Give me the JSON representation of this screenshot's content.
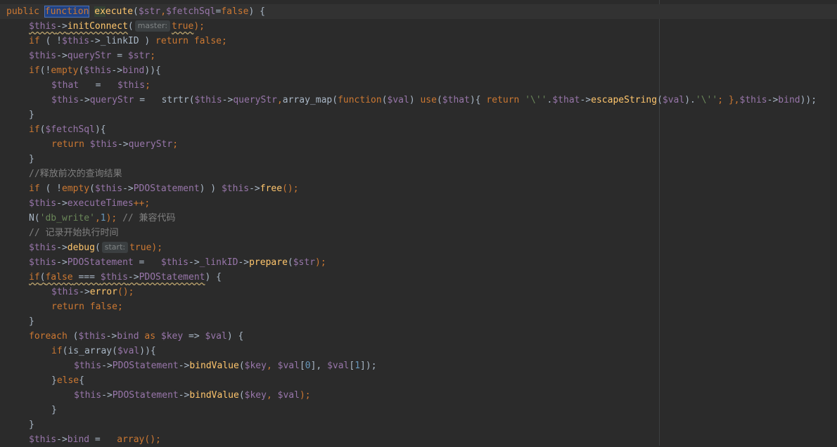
{
  "editor": {
    "line0": {
      "kw_public": "public",
      "kw_function": "function",
      "fn_name_a": "ex",
      "fn_name_b": "ecute",
      "paren": "(",
      "p1": "$str",
      "comma": ",",
      "p2": "$fetchSql",
      "eq": "=",
      "default": "false",
      "close": ") {"
    },
    "line1": {
      "this": "$this",
      "arrow": "->",
      "method": "initConnect",
      "open": "(",
      "hint": "master:",
      "arg": "true",
      "close": ");"
    },
    "line2": {
      "kw_if": "if",
      "open": " ( !",
      "this": "$this",
      "arrow": "->",
      "prop": "_linkID",
      "close": " ) ",
      "kw_return": "return",
      "kw_false": "false",
      ";": ";"
    },
    "line3": {
      "this": "$this",
      "arrow": "->",
      "prop": "queryStr",
      "eq": " = ",
      "var": "$str",
      "end": ";"
    },
    "line4": {
      "kw_if": "if",
      "open": "(!",
      "kw_empty": "empty",
      "open2": "(",
      "this": "$this",
      "arrow": "->",
      "prop": "bind",
      "close": ")){"
    },
    "line5": {
      "var": "$that",
      "eq": "   =   ",
      "this": "$this",
      "end": ";"
    },
    "line6": {
      "this": "$this",
      "arrow": "->",
      "prop": "queryStr",
      "eq": " =   ",
      "fn1": "strtr(",
      "this2": "$this",
      "arrow2": "->",
      "prop2": "queryStr",
      "comma": ",",
      "fn2": "array_map(",
      "kw_function": "function",
      "paren": "(",
      "val": "$val",
      "paren2": ") ",
      "kw_use": "use",
      "paren3": "(",
      "that": "$that",
      "paren4": "){ ",
      "kw_return": "return",
      "sp": " ",
      "str1": "'\\''",
      "dot": ".",
      "that2": "$that",
      "arrow3": "->",
      "method": "escapeString",
      "paren5": "(",
      "val2": "$val",
      "paren6": ").",
      "str2": "'\\''",
      "end": "; },",
      "this3": "$this",
      "arrow4": "->",
      "prop3": "bind",
      "close": "));"
    },
    "line7": {
      "brace": "}"
    },
    "line8": {
      "kw_if": "if",
      "open": "(",
      "var": "$fetchSql",
      "close": "){"
    },
    "line9": {
      "kw_return": "return",
      "sp": " ",
      "this": "$this",
      "arrow": "->",
      "prop": "queryStr",
      "end": ";"
    },
    "line10": {
      "brace": "}"
    },
    "line11": {
      "comment": "//释放前次的查询结果"
    },
    "line12": {
      "kw_if": "if",
      "open": " ( !",
      "kw_empty": "empty",
      "open2": "(",
      "this": "$this",
      "arrow": "->",
      "prop": "PDOStatement",
      "close": ") ) ",
      "this2": "$this",
      "arrow2": "->",
      "method": "free",
      "end": "();"
    },
    "line13": {
      "this": "$this",
      "arrow": "->",
      "prop": "executeTimes",
      "end": "++;"
    },
    "line14": {
      "fn": "N(",
      "str": "'db_write'",
      "comma": ",",
      "num": "1",
      "close": "); ",
      "comment": "// 兼容代码"
    },
    "line15": {
      "comment": "// 记录开始执行时间"
    },
    "line16": {
      "this": "$this",
      "arrow": "->",
      "method": "debug",
      "open": "(",
      "hint": "start:",
      "arg": "true",
      "close": ");"
    },
    "line17": {
      "this": "$this",
      "arrow": "->",
      "prop": "PDOStatement",
      "eq": " =   ",
      "this2": "$this",
      "arrow2": "->",
      "prop2": "_linkID",
      "arrow3": "->",
      "method": "prepare",
      "open": "(",
      "var": "$str",
      "close": ");"
    },
    "line18": {
      "kw_if": "if",
      "open": "(",
      "kw_false": "false",
      "op": " === ",
      "this": "$this",
      "arrow": "->",
      "prop": "PDOStatement",
      "close": ") {"
    },
    "line19": {
      "this": "$this",
      "arrow": "->",
      "method": "error",
      "end": "();"
    },
    "line20": {
      "kw_return": "return",
      "sp": " ",
      "kw_false": "false",
      "end": ";"
    },
    "line21": {
      "brace": "}"
    },
    "line22": {
      "kw_foreach": "foreach",
      "open": " (",
      "this": "$this",
      "arrow": "->",
      "prop": "bind",
      "kw_as": " as ",
      "key": "$key",
      "op": " => ",
      "val": "$val",
      "close": ") {"
    },
    "line23": {
      "kw_if": "if",
      "open": "(",
      "fn": "is_array",
      "open2": "(",
      "val": "$val",
      "close": ")){"
    },
    "line24": {
      "this": "$this",
      "arrow": "->",
      "prop": "PDOStatement",
      "arrow2": "->",
      "method": "bindValue",
      "open": "(",
      "key": "$key",
      "comma": ", ",
      "val": "$val",
      "idx0": "[",
      "n0": "0",
      "idxc": "], ",
      "val2": "$val",
      "idx1": "[",
      "n1": "1",
      "close": "]);"
    },
    "line25": {
      "brace": "}",
      "kw_else": "else",
      "open": "{"
    },
    "line26": {
      "this": "$this",
      "arrow": "->",
      "prop": "PDOStatement",
      "arrow2": "->",
      "method": "bindValue",
      "open": "(",
      "key": "$key",
      "comma": ", ",
      "val": "$val",
      "close": ");"
    },
    "line27": {
      "brace": "}"
    },
    "line28": {
      "brace": "}"
    },
    "line29": {
      "this": "$this",
      "arrow": "->",
      "prop": "bind",
      "eq": " =   ",
      "fn": "array",
      "end": "();"
    }
  },
  "colors": {
    "background": "#2b2b2b",
    "keyword": "#cc7832",
    "variable": "#9876aa",
    "method": "#ffc66d",
    "string": "#6a8759",
    "number": "#6897bb",
    "comment": "#808080",
    "text": "#a9b7c6"
  }
}
